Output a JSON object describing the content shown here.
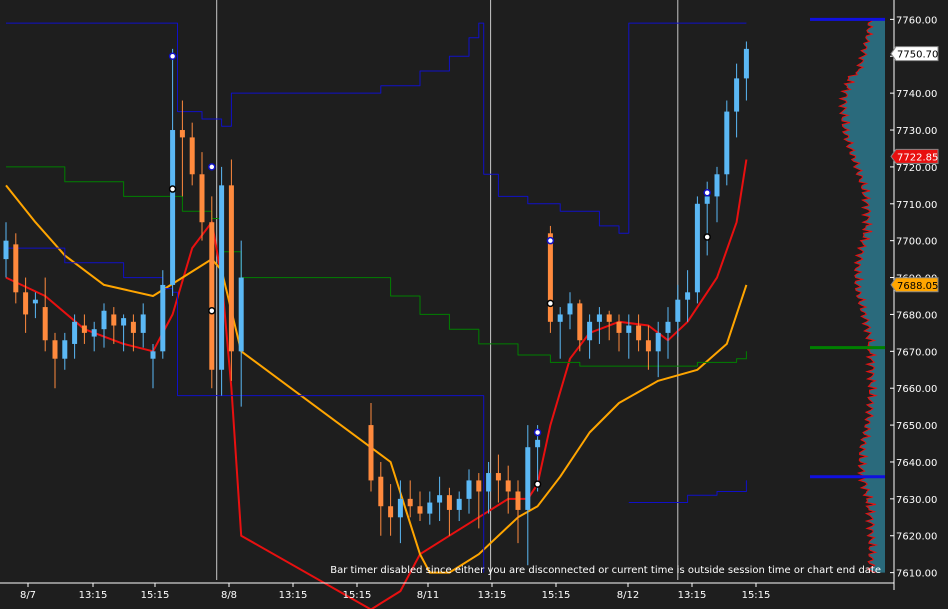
{
  "chart_data": {
    "type": "candlestick",
    "ylim": [
      7608,
      7762
    ],
    "y_ticks": [
      7610,
      7620,
      7630,
      7640,
      7650,
      7660,
      7670,
      7680,
      7690,
      7700,
      7710,
      7720,
      7730,
      7740,
      7750,
      7760
    ],
    "x_ticks": [
      "8/7",
      "13:15",
      "15:15",
      "8/8",
      "13:15",
      "15:15",
      "8/11",
      "13:15",
      "15:15",
      "8/12",
      "13:15",
      "15:15"
    ],
    "price_badges": [
      {
        "label": "7750.70",
        "value": 7750.7,
        "bg": "#ffffff",
        "fg": "#000000"
      },
      {
        "label": "7722.85",
        "value": 7722.85,
        "bg": "#e81010",
        "fg": "#ffffff"
      },
      {
        "label": "7688.05",
        "value": 7688.05,
        "bg": "#ffa500",
        "fg": "#000000"
      }
    ],
    "profile_levels": [
      {
        "value": 7760,
        "color": "#1010e0"
      },
      {
        "value": 7671,
        "color": "#008000"
      },
      {
        "value": 7636,
        "color": "#1010e0"
      }
    ],
    "candles": [
      [
        7695,
        7705,
        7690,
        7700
      ],
      [
        7699,
        7702,
        7683,
        7686
      ],
      [
        7686,
        7690,
        7675,
        7680
      ],
      [
        7683,
        7686,
        7679,
        7684
      ],
      [
        7682,
        7690,
        7670,
        7673
      ],
      [
        7673,
        7675,
        7660,
        7668
      ],
      [
        7668,
        7675,
        7665,
        7673
      ],
      [
        7672,
        7680,
        7668,
        7678
      ],
      [
        7677,
        7680,
        7672,
        7675
      ],
      [
        7674,
        7678,
        7670,
        7676
      ],
      [
        7676,
        7683,
        7671,
        7681
      ],
      [
        7680,
        7682,
        7672,
        7677
      ],
      [
        7677,
        7680,
        7670,
        7679
      ],
      [
        7678,
        7680,
        7670,
        7675
      ],
      [
        7675,
        7683,
        7671,
        7680
      ],
      [
        7668,
        7672,
        7660,
        7670
      ],
      [
        7670,
        7692,
        7668,
        7688
      ],
      [
        7688,
        7752,
        7685,
        7730
      ],
      [
        7730,
        7738,
        7712,
        7728
      ],
      [
        7728,
        7732,
        7715,
        7718
      ],
      [
        7718,
        7724,
        7700,
        7705
      ],
      [
        7705,
        7712,
        7660,
        7665
      ],
      [
        7665,
        7720,
        7658,
        7715
      ],
      [
        7715,
        7722,
        7662,
        7670
      ],
      [
        7670,
        7700,
        7655,
        7690
      ],
      [
        7650,
        7656,
        7632,
        7635
      ],
      [
        7636,
        7640,
        7620,
        7628
      ],
      [
        7628,
        7634,
        7620,
        7625
      ],
      [
        7625,
        7635,
        7618,
        7630
      ],
      [
        7630,
        7635,
        7625,
        7628
      ],
      [
        7628,
        7632,
        7624,
        7626
      ],
      [
        7626,
        7632,
        7623,
        7629
      ],
      [
        7629,
        7636,
        7624,
        7631
      ],
      [
        7631,
        7633,
        7620,
        7627
      ],
      [
        7627,
        7632,
        7624,
        7630
      ],
      [
        7630,
        7638,
        7626,
        7635
      ],
      [
        7635,
        7637,
        7622,
        7632
      ],
      [
        7632,
        7640,
        7626,
        7637
      ],
      [
        7637,
        7642,
        7629,
        7635
      ],
      [
        7635,
        7639,
        7626,
        7632
      ],
      [
        7632,
        7635,
        7618,
        7627
      ],
      [
        7627,
        7650,
        7612,
        7644
      ],
      [
        7644,
        7650,
        7632,
        7646
      ],
      [
        7702,
        7704,
        7675,
        7678
      ],
      [
        7678,
        7682,
        7668,
        7680
      ],
      [
        7680,
        7686,
        7676,
        7683
      ],
      [
        7683,
        7684,
        7670,
        7673
      ],
      [
        7673,
        7680,
        7668,
        7678
      ],
      [
        7678,
        7682,
        7672,
        7680
      ],
      [
        7680,
        7681,
        7673,
        7678
      ],
      [
        7678,
        7680,
        7670,
        7675
      ],
      [
        7675,
        7680,
        7668,
        7677
      ],
      [
        7677,
        7680,
        7670,
        7673
      ],
      [
        7673,
        7677,
        7665,
        7670
      ],
      [
        7670,
        7678,
        7663,
        7675
      ],
      [
        7675,
        7682,
        7668,
        7678
      ],
      [
        7678,
        7688,
        7674,
        7684
      ],
      [
        7684,
        7692,
        7678,
        7686
      ],
      [
        7686,
        7712,
        7683,
        7710
      ],
      [
        7710,
        7716,
        7696,
        7712
      ],
      [
        7712,
        7720,
        7705,
        7718
      ],
      [
        7718,
        7738,
        7715,
        7735
      ],
      [
        7735,
        7748,
        7728,
        7744
      ],
      [
        7744,
        7754,
        7738,
        7752
      ]
    ],
    "series": [
      {
        "type": "line",
        "color": "#e81010",
        "width": 2,
        "points": [
          [
            0,
            7690
          ],
          [
            4,
            7685
          ],
          [
            8,
            7676
          ],
          [
            12,
            7672
          ],
          [
            15,
            7670
          ],
          [
            17,
            7680
          ],
          [
            19,
            7698
          ],
          [
            21,
            7705
          ],
          [
            22,
            7690
          ],
          [
            23,
            7660
          ],
          [
            24,
            7620
          ],
          [
            25,
            7600
          ],
          [
            28,
            7605
          ],
          [
            30,
            7615
          ],
          [
            33,
            7620
          ],
          [
            36,
            7625
          ],
          [
            39,
            7630
          ],
          [
            41,
            7630
          ],
          [
            42,
            7634
          ],
          [
            43,
            7650
          ],
          [
            45,
            7668
          ],
          [
            47,
            7675
          ],
          [
            50,
            7678
          ],
          [
            53,
            7677
          ],
          [
            55,
            7673
          ],
          [
            57,
            7678
          ],
          [
            60,
            7690
          ],
          [
            62,
            7705
          ],
          [
            63,
            7722
          ]
        ]
      },
      {
        "type": "line",
        "color": "#ffa500",
        "width": 2,
        "points": [
          [
            0,
            7715
          ],
          [
            3,
            7705
          ],
          [
            6,
            7696
          ],
          [
            10,
            7688
          ],
          [
            15,
            7685
          ],
          [
            18,
            7690
          ],
          [
            21,
            7695
          ],
          [
            22,
            7692
          ],
          [
            24,
            7670
          ],
          [
            27,
            7640
          ],
          [
            30,
            7615
          ],
          [
            31,
            7610
          ],
          [
            33,
            7610
          ],
          [
            36,
            7615
          ],
          [
            40,
            7625
          ],
          [
            42,
            7628
          ],
          [
            44,
            7636
          ],
          [
            47,
            7648
          ],
          [
            50,
            7656
          ],
          [
            54,
            7662
          ],
          [
            58,
            7665
          ],
          [
            61,
            7672
          ],
          [
            63,
            7688
          ]
        ]
      },
      {
        "type": "step",
        "color": "#008000",
        "width": 1,
        "points": [
          [
            0,
            7720
          ],
          [
            6,
            7716
          ],
          [
            12,
            7712
          ],
          [
            18,
            7708
          ],
          [
            21,
            7706
          ],
          [
            22,
            7697
          ],
          [
            24,
            7690
          ],
          [
            27,
            7685
          ],
          [
            30,
            7680
          ],
          [
            33,
            7676
          ],
          [
            36,
            7672
          ],
          [
            40,
            7669
          ],
          [
            43,
            7667
          ],
          [
            46,
            7666
          ],
          [
            52,
            7666
          ],
          [
            58,
            7667
          ],
          [
            62,
            7668
          ],
          [
            63,
            7670
          ]
        ]
      },
      {
        "type": "step",
        "color": "#1010c8",
        "width": 1,
        "points": [
          [
            0,
            7759
          ],
          [
            17,
            7759
          ],
          [
            17.5,
            7735
          ],
          [
            20,
            7733
          ],
          [
            22,
            7731
          ],
          [
            23,
            7740
          ],
          [
            26,
            7742
          ],
          [
            30,
            7746
          ],
          [
            33,
            7750
          ],
          [
            35,
            7755
          ],
          [
            36,
            7759
          ],
          [
            36.5,
            7718
          ],
          [
            38,
            7712
          ],
          [
            41,
            7710
          ],
          [
            44,
            7708
          ],
          [
            48,
            7704
          ],
          [
            50,
            7702
          ],
          [
            51,
            7759
          ],
          [
            63,
            7759
          ]
        ]
      },
      {
        "type": "step",
        "color": "#1010c8",
        "width": 1,
        "points": [
          [
            0,
            7698
          ],
          [
            6,
            7694
          ],
          [
            12,
            7690
          ],
          [
            16,
            7687
          ],
          [
            17,
            7686
          ],
          [
            17.5,
            7658
          ],
          [
            36,
            7658
          ],
          [
            36.5,
            7610
          ]
        ]
      },
      {
        "type": "step",
        "color": "#1010c8",
        "width": 1,
        "points": [
          [
            51,
            7629
          ],
          [
            54,
            7629
          ],
          [
            57,
            7631
          ],
          [
            60,
            7632
          ],
          [
            63,
            7635
          ]
        ]
      }
    ],
    "markers": [
      {
        "i": 17,
        "v": 7750,
        "fill": "#ffffff",
        "stroke": "#1010c8"
      },
      {
        "i": 17,
        "v": 7714,
        "fill": "#ffffff",
        "stroke": "#000000"
      },
      {
        "i": 21,
        "v": 7720,
        "fill": "#ffffff",
        "stroke": "#1010c8"
      },
      {
        "i": 21,
        "v": 7681,
        "fill": "#ffffff",
        "stroke": "#000000"
      },
      {
        "i": 42,
        "v": 7648,
        "fill": "#ffffff",
        "stroke": "#1010c8"
      },
      {
        "i": 42,
        "v": 7634,
        "fill": "#ffffff",
        "stroke": "#000000"
      },
      {
        "i": 43,
        "v": 7700,
        "fill": "#ffffff",
        "stroke": "#1010c8"
      },
      {
        "i": 43,
        "v": 7683,
        "fill": "#ffffff",
        "stroke": "#000000"
      },
      {
        "i": 59,
        "v": 7713,
        "fill": "#ffffff",
        "stroke": "#1010c8"
      },
      {
        "i": 59,
        "v": 7701,
        "fill": "#ffffff",
        "stroke": "#000000"
      }
    ],
    "up_color": "#5bb8f5",
    "down_color": "#ff8a3d",
    "background": "#1e1e1e",
    "profile_color": "#2a6a7c",
    "profile_outline": "#e81010"
  },
  "status_text": "Bar timer disabled since either you are disconnected or current time is outside session time or chart end date"
}
